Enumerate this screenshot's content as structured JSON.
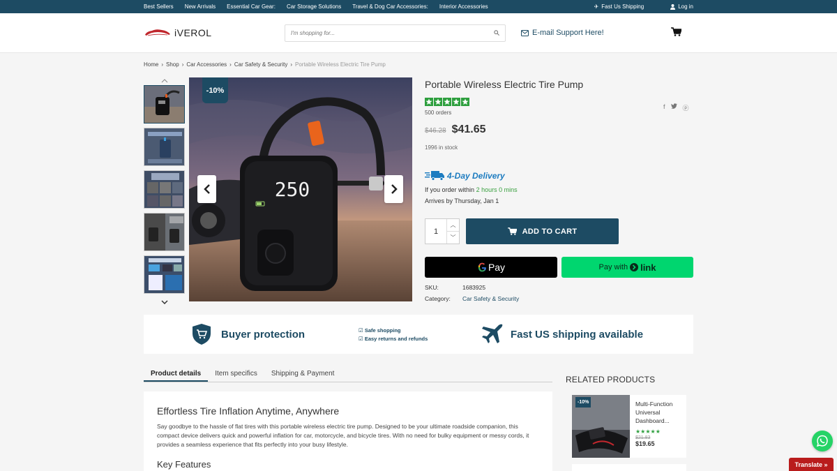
{
  "topbar": {
    "links": [
      "Best Sellers",
      "New Arrivals",
      "Essential Car Gear:",
      "Car Storage Solutions",
      "Travel & Dog Car Accessories:",
      "Interior Accessories"
    ],
    "shipping": "Fast Us Shipping",
    "login": "Log in"
  },
  "header": {
    "logo_text": "iVEROL",
    "search_placeholder": "I'm shopping for...",
    "email_support": "E-mail Support Here!"
  },
  "breadcrumb": [
    "Home",
    "Shop",
    "Car Accessories",
    "Car Safety & Security",
    "Portable Wireless Electric Tire Pump"
  ],
  "gallery": {
    "discount": "-10%",
    "display_reading": "250"
  },
  "product": {
    "title": "Portable Wireless Electric Tire Pump",
    "rating": 5,
    "orders": "500 orders",
    "old_price": "$46.28",
    "price": "$41.65",
    "stock": "1996 in stock",
    "delivery_label": "4-Day Delivery",
    "order_within_prefix": "If you order within",
    "order_within_time": "2 hours 0 mins",
    "arrives": "Arrives by Thursday, Jan 1",
    "quantity": "1",
    "add_to_cart": "ADD TO CART",
    "gpay_label": "Pay",
    "link_prefix": "Pay with",
    "link_label": "link",
    "sku_label": "SKU:",
    "sku": "1683925",
    "category_label": "Category:",
    "category": "Car Safety & Security"
  },
  "trust": {
    "buyer_protection": "Buyer protection",
    "check1": "Safe shopping",
    "check2": "Easy returns and refunds",
    "fast_shipping": "Fast US shipping available"
  },
  "tabs": [
    "Product details",
    "Item specifics",
    "Shipping & Payment"
  ],
  "description": {
    "heading": "Effortless Tire Inflation Anytime, Anywhere",
    "body": "Say goodbye to the hassle of flat tires with this portable wireless electric tire pump. Designed to be your ultimate roadside companion, this compact device delivers quick and powerful inflation for car, motorcycle, and bicycle tires. With no need for bulky equipment or messy cords, it provides a seamless experience that fits perfectly into your busy lifestyle.",
    "key_features": "Key Features"
  },
  "related": {
    "heading": "RELATED PRODUCTS",
    "items": [
      {
        "tag": "-10%",
        "name": "Multi-Function Universal Dashboard...",
        "rating": 5,
        "old_price": "$21.83",
        "price": "$19.65"
      }
    ]
  },
  "floating": {
    "translate": "Translate »"
  },
  "colors": {
    "brand": "#1d4b63",
    "star": "#2e9f3e",
    "link_green": "#00d66f",
    "delivery_blue": "#1d7cc0"
  }
}
